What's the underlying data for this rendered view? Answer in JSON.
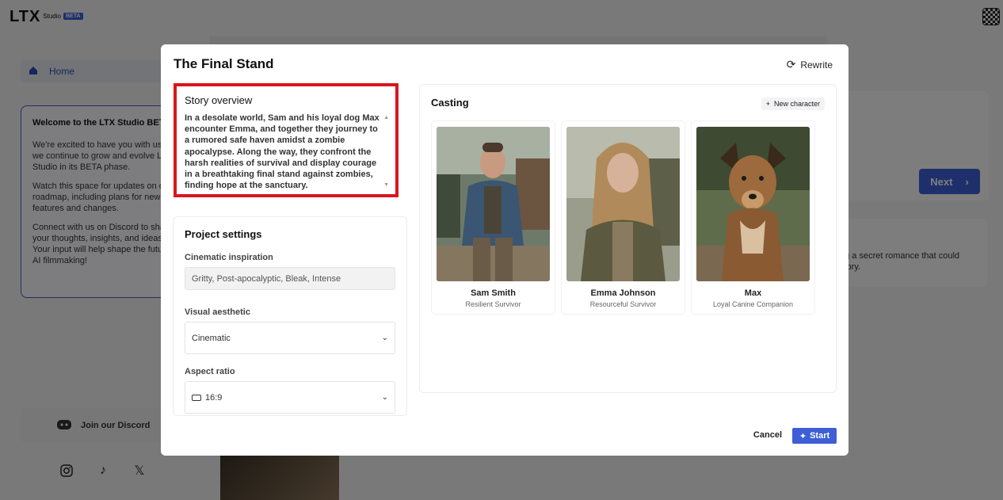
{
  "app": {
    "logo": "LTX",
    "logo_sub": "Studio",
    "logo_badge": "BETA"
  },
  "sidebar": {
    "home_label": "Home",
    "welcome_title": "Welcome to the LTX Studio BETA",
    "welcome_p1": "We're excited to have you with us as we continue to grow and evolve LTX Studio in its BETA phase.",
    "welcome_p2": "Watch this space for updates on our roadmap, including plans for new features and changes.",
    "welcome_p3": "Connect with us on Discord to share your thoughts, insights, and ideas. Your input will help shape the future of AI filmmaking!",
    "discord_label": "Join our Discord"
  },
  "background": {
    "next_label": "Next",
    "panel_text": "ng a secret romance that could story."
  },
  "modal": {
    "title": "The Final Stand",
    "rewrite_label": "Rewrite",
    "story_title": "Story overview",
    "story_text": "In a desolate world, Sam and his loyal dog Max encounter Emma, and together they journey to a rumored safe haven amidst a zombie apocalypse. Along the way, they confront the harsh realities of survival and display courage in a breathtaking final stand against zombies, finding hope at the sanctuary.",
    "settings_title": "Project settings",
    "cinematic_label": "Cinematic inspiration",
    "cinematic_value": "Gritty, Post-apocalyptic, Bleak, Intense",
    "aesthetic_label": "Visual aesthetic",
    "aesthetic_value": "Cinematic",
    "aspect_label": "Aspect ratio",
    "aspect_value": "16:9",
    "casting_title": "Casting",
    "new_character_label": "New character",
    "characters": [
      {
        "name": "Sam Smith",
        "role": "Resilient Survivor"
      },
      {
        "name": "Emma Johnson",
        "role": "Resourceful Survivor"
      },
      {
        "name": "Max",
        "role": "Loyal Canine Companion"
      }
    ],
    "cancel_label": "Cancel",
    "start_label": "Start"
  }
}
